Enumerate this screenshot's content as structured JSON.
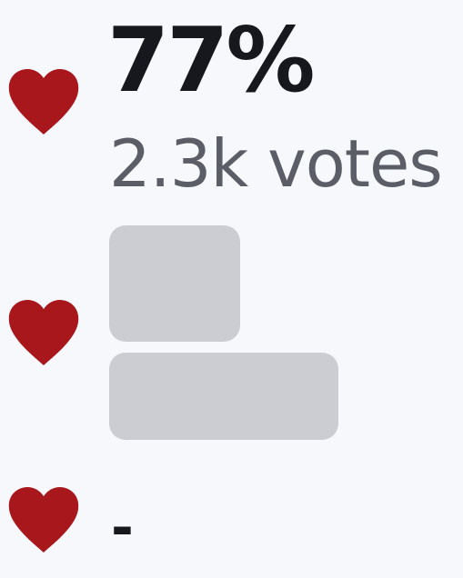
{
  "colors": {
    "heart": "#a8171c",
    "skeleton": "#cbcdd3",
    "background": "#f7f8fc",
    "text_primary": "#16181d",
    "text_secondary": "#5b5e66"
  },
  "rows": [
    {
      "state": "loaded",
      "icon": "heart-icon",
      "score_label": "77%",
      "votes_label": "2.3k votes"
    },
    {
      "state": "loading",
      "icon": "heart-icon"
    },
    {
      "state": "empty",
      "icon": "heart-icon",
      "value_label": "-"
    }
  ]
}
